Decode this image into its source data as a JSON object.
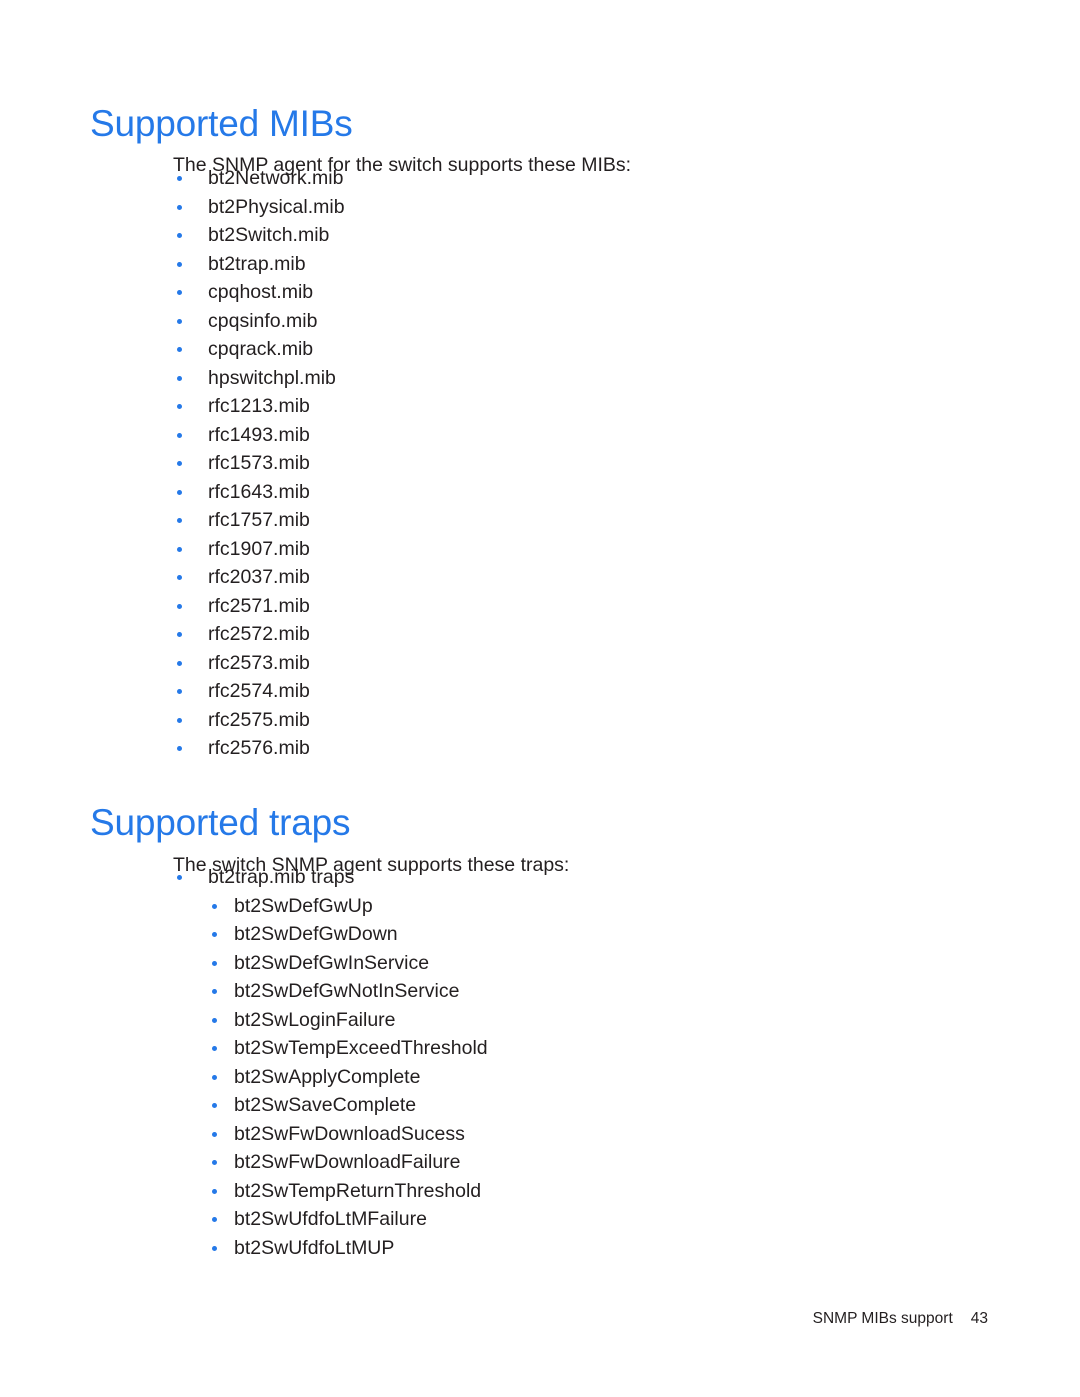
{
  "document": {
    "accent_color": "#2579e8",
    "text_color": "#231f20",
    "background_color": "#ffffff"
  },
  "sections": [
    {
      "heading": "Supported MIBs",
      "intro": "The SNMP agent for the switch supports these MIBs:"
    },
    {
      "heading": "Supported traps",
      "intro": "The switch SNMP agent supports these traps:"
    }
  ],
  "mibs_list": [
    {
      "level": 1,
      "label": "bt2Network.mib"
    },
    {
      "level": 1,
      "label": "bt2Physical.mib"
    },
    {
      "level": 1,
      "label": "bt2Switch.mib"
    },
    {
      "level": 1,
      "label": "bt2trap.mib"
    },
    {
      "level": 1,
      "label": "cpqhost.mib"
    },
    {
      "level": 1,
      "label": "cpqsinfo.mib"
    },
    {
      "level": 1,
      "label": "cpqrack.mib"
    },
    {
      "level": 1,
      "label": "hpswitchpl.mib"
    },
    {
      "level": 1,
      "label": "rfc1213.mib"
    },
    {
      "level": 1,
      "label": "rfc1493.mib"
    },
    {
      "level": 1,
      "label": "rfc1573.mib"
    },
    {
      "level": 1,
      "label": "rfc1643.mib"
    },
    {
      "level": 1,
      "label": "rfc1757.mib"
    },
    {
      "level": 1,
      "label": "rfc1907.mib"
    },
    {
      "level": 1,
      "label": "rfc2037.mib"
    },
    {
      "level": 1,
      "label": "rfc2571.mib"
    },
    {
      "level": 1,
      "label": "rfc2572.mib"
    },
    {
      "level": 1,
      "label": "rfc2573.mib"
    },
    {
      "level": 1,
      "label": "rfc2574.mib"
    },
    {
      "level": 1,
      "label": "rfc2575.mib"
    },
    {
      "level": 1,
      "label": "rfc2576.mib"
    }
  ],
  "traps_list": [
    {
      "level": 1,
      "label": "bt2trap.mib traps"
    },
    {
      "level": 2,
      "label": "bt2SwDefGwUp"
    },
    {
      "level": 2,
      "label": "bt2SwDefGwDown"
    },
    {
      "level": 2,
      "label": "bt2SwDefGwInService"
    },
    {
      "level": 2,
      "label": "bt2SwDefGwNotInService"
    },
    {
      "level": 2,
      "label": "bt2SwLoginFailure"
    },
    {
      "level": 2,
      "label": "bt2SwTempExceedThreshold"
    },
    {
      "level": 2,
      "label": "bt2SwApplyComplete"
    },
    {
      "level": 2,
      "label": "bt2SwSaveComplete"
    },
    {
      "level": 2,
      "label": "bt2SwFwDownloadSucess"
    },
    {
      "level": 2,
      "label": "bt2SwFwDownloadFailure"
    },
    {
      "level": 2,
      "label": "bt2SwTempReturnThreshold"
    },
    {
      "level": 2,
      "label": "bt2SwUfdfoLtMFailure"
    },
    {
      "level": 2,
      "label": "bt2SwUfdfoLtMUP"
    }
  ],
  "footer": {
    "label": "SNMP MIBs support",
    "page_number": "43"
  }
}
